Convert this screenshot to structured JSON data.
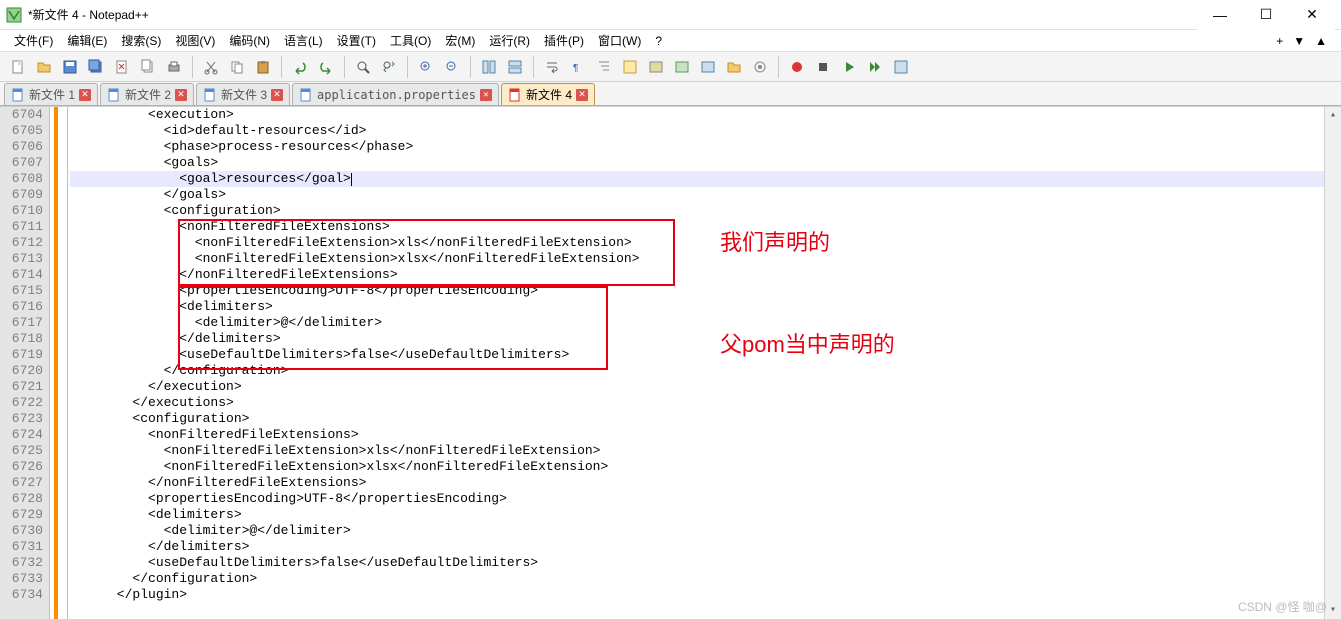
{
  "window": {
    "title": "*新文件 4 - Notepad++"
  },
  "menus": {
    "file": "文件(F)",
    "edit": "编辑(E)",
    "search": "搜索(S)",
    "view": "视图(V)",
    "encoding": "编码(N)",
    "language": "语言(L)",
    "settings": "设置(T)",
    "tools": "工具(O)",
    "macro": "宏(M)",
    "run": "运行(R)",
    "plugins": "插件(P)",
    "window": "窗口(W)",
    "help": "?"
  },
  "tabs": [
    {
      "label": "新文件 1",
      "active": false
    },
    {
      "label": "新文件 2",
      "active": false
    },
    {
      "label": "新文件 3",
      "active": false
    },
    {
      "label": "application.properties",
      "active": false,
      "prop": true
    },
    {
      "label": "新文件 4",
      "active": true
    }
  ],
  "gutter_start": 6704,
  "gutter_end": 6734,
  "current_line_index": 4,
  "code_lines": [
    "          <execution>",
    "            <id>default-resources</id>",
    "            <phase>process-resources</phase>",
    "            <goals>",
    "              <goal>resources</goal>",
    "            </goals>",
    "            <configuration>",
    "              <nonFilteredFileExtensions>",
    "                <nonFilteredFileExtension>xls</nonFilteredFileExtension>",
    "                <nonFilteredFileExtension>xlsx</nonFilteredFileExtension>",
    "              </nonFilteredFileExtensions>",
    "              <propertiesEncoding>UTF-8</propertiesEncoding>",
    "              <delimiters>",
    "                <delimiter>@</delimiter>",
    "              </delimiters>",
    "              <useDefaultDelimiters>false</useDefaultDelimiters>",
    "            </configuration>",
    "          </execution>",
    "        </executions>",
    "        <configuration>",
    "          <nonFilteredFileExtensions>",
    "            <nonFilteredFileExtension>xls</nonFilteredFileExtension>",
    "            <nonFilteredFileExtension>xlsx</nonFilteredFileExtension>",
    "          </nonFilteredFileExtensions>",
    "          <propertiesEncoding>UTF-8</propertiesEncoding>",
    "          <delimiters>",
    "            <delimiter>@</delimiter>",
    "          </delimiters>",
    "          <useDefaultDelimiters>false</useDefaultDelimiters>",
    "        </configuration>",
    "      </plugin>"
  ],
  "annotations": {
    "a1": "我们声明的",
    "a2": "父pom当中声明的"
  },
  "watermark": "CSDN @怪 咖@"
}
